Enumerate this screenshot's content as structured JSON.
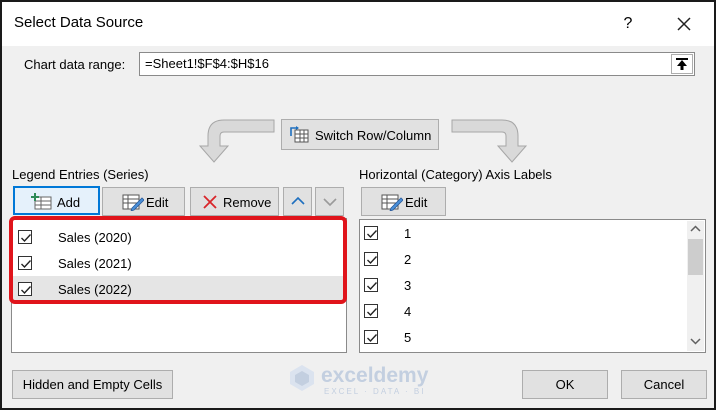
{
  "dialog": {
    "title": "Select Data Source",
    "help": "?",
    "close_icon": "close-icon"
  },
  "range": {
    "label": "Chart data range:",
    "value": "=Sheet1!$F$4:$H$16"
  },
  "switch_button": {
    "label": "Switch Row/Column"
  },
  "legend": {
    "label": "Legend Entries (Series)",
    "toolbar": {
      "add": "Add",
      "edit": "Edit",
      "remove": "Remove"
    },
    "items": [
      {
        "label": "Sales (2020)",
        "checked": true
      },
      {
        "label": "Sales (2021)",
        "checked": true
      },
      {
        "label": "Sales (2022)",
        "checked": true,
        "selected": true
      }
    ]
  },
  "axis": {
    "label": "Horizontal (Category) Axis Labels",
    "edit": "Edit",
    "items": [
      {
        "label": "1",
        "checked": true
      },
      {
        "label": "2",
        "checked": true
      },
      {
        "label": "3",
        "checked": true
      },
      {
        "label": "4",
        "checked": true
      },
      {
        "label": "5",
        "checked": true
      }
    ]
  },
  "footer": {
    "hidden_empty": "Hidden and Empty Cells",
    "ok": "OK",
    "cancel": "Cancel"
  },
  "watermark": {
    "name": "exceldemy",
    "tagline": "EXCEL · DATA · BI"
  },
  "colors": {
    "highlight": "#e0141b",
    "remove_icon": "#d9252a",
    "focus": "#0078d7"
  }
}
